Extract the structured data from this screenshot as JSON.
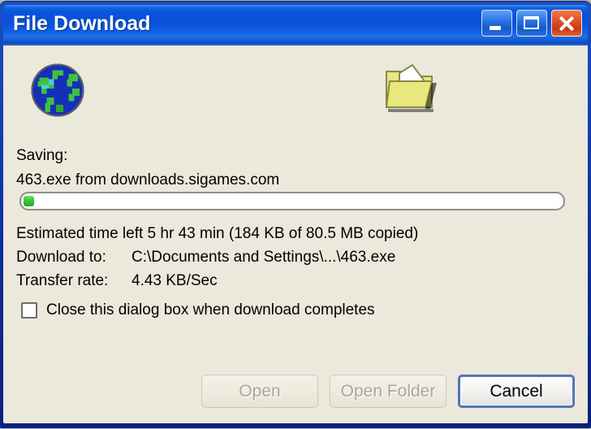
{
  "window": {
    "title": "File Download",
    "caption_buttons": [
      {
        "name": "minimize",
        "label": "Minimize"
      },
      {
        "name": "maximize",
        "label": "Maximize"
      },
      {
        "name": "close",
        "label": "Close"
      }
    ],
    "colors": {
      "titlebar_blue": "#0a54dc",
      "close_red": "#c63a15",
      "body_background": "#ebe8dc",
      "progress_green": "#35c335",
      "default_button_border": "#4f77b8"
    }
  },
  "icons": {
    "source": "globe-icon",
    "destination": "folder-icon"
  },
  "content": {
    "saving_label": "Saving:",
    "saving_value": "463.exe from downloads.sigames.com",
    "estimated_time_row": "Estimated time left  5 hr 43 min (184 KB of 80.5 MB copied)",
    "estimated_time_label": "Estimated time left",
    "estimated_time_value": "5 hr 43 min (184 KB of 80.5 MB copied)",
    "download_to_label": "Download to:",
    "download_to_value": "C:\\Documents and Settings\\...\\463.exe",
    "transfer_rate_label": "Transfer rate:",
    "transfer_rate_value": "4.43 KB/Sec"
  },
  "progress": {
    "percent": 0.22,
    "bytes_copied": "184 KB",
    "total_size": "80.5 MB"
  },
  "checkbox": {
    "label": "Close this dialog box when download completes",
    "checked": false
  },
  "buttons": [
    {
      "label": "Open",
      "enabled": false
    },
    {
      "label": "Open Folder",
      "enabled": false
    },
    {
      "label": "Cancel",
      "enabled": true
    }
  ]
}
